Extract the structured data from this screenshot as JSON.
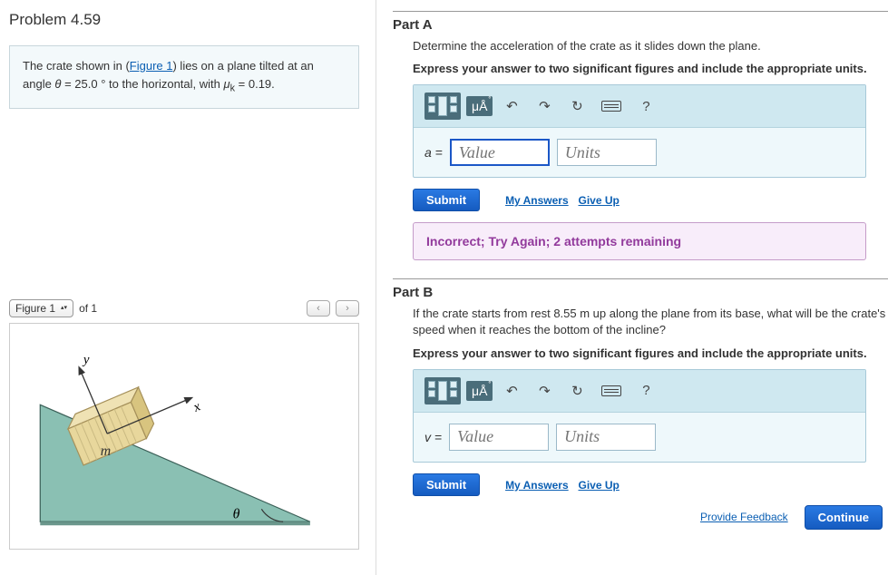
{
  "problem": {
    "title": "Problem 4.59",
    "statement_pre": "The crate shown in (",
    "figure_link": "Figure 1",
    "statement_mid": ") lies on a plane tilted at an angle ",
    "theta_label": "θ",
    "statement_theta": " = 25.0 ° to the horizontal, with ",
    "mu_label": "μ",
    "mu_sub": "k",
    "statement_mu": " = 0.19."
  },
  "figure": {
    "selector_label": "Figure 1",
    "count_label": "of 1",
    "labels": {
      "y": "y",
      "x": "x",
      "m": "m",
      "theta": "θ"
    }
  },
  "toolbar": {
    "units_label": "μÅ",
    "undo_title": "Undo",
    "redo_title": "Redo",
    "reset_title": "Reset",
    "keyboard_title": "Keyboard",
    "help": "?"
  },
  "partA": {
    "title": "Part A",
    "prompt": "Determine the acceleration of the crate as it slides down the plane.",
    "instruct": "Express your answer to two significant figures and include the appropriate units.",
    "var": "a =",
    "value_ph": "Value",
    "units_ph": "Units",
    "submit": "Submit",
    "my_answers": "My Answers",
    "give_up": "Give Up",
    "feedback": "Incorrect; Try Again; 2 attempts remaining"
  },
  "partB": {
    "title": "Part B",
    "prompt": "If the crate starts from rest 8.55  m up along the plane from its base, what will be the crate's speed when it reaches the bottom of the incline?",
    "instruct": "Express your answer to two significant figures and include the appropriate units.",
    "var": "v =",
    "value_ph": "Value",
    "units_ph": "Units",
    "submit": "Submit",
    "my_answers": "My Answers",
    "give_up": "Give Up"
  },
  "footer": {
    "provide_feedback": "Provide Feedback",
    "continue": "Continue"
  }
}
